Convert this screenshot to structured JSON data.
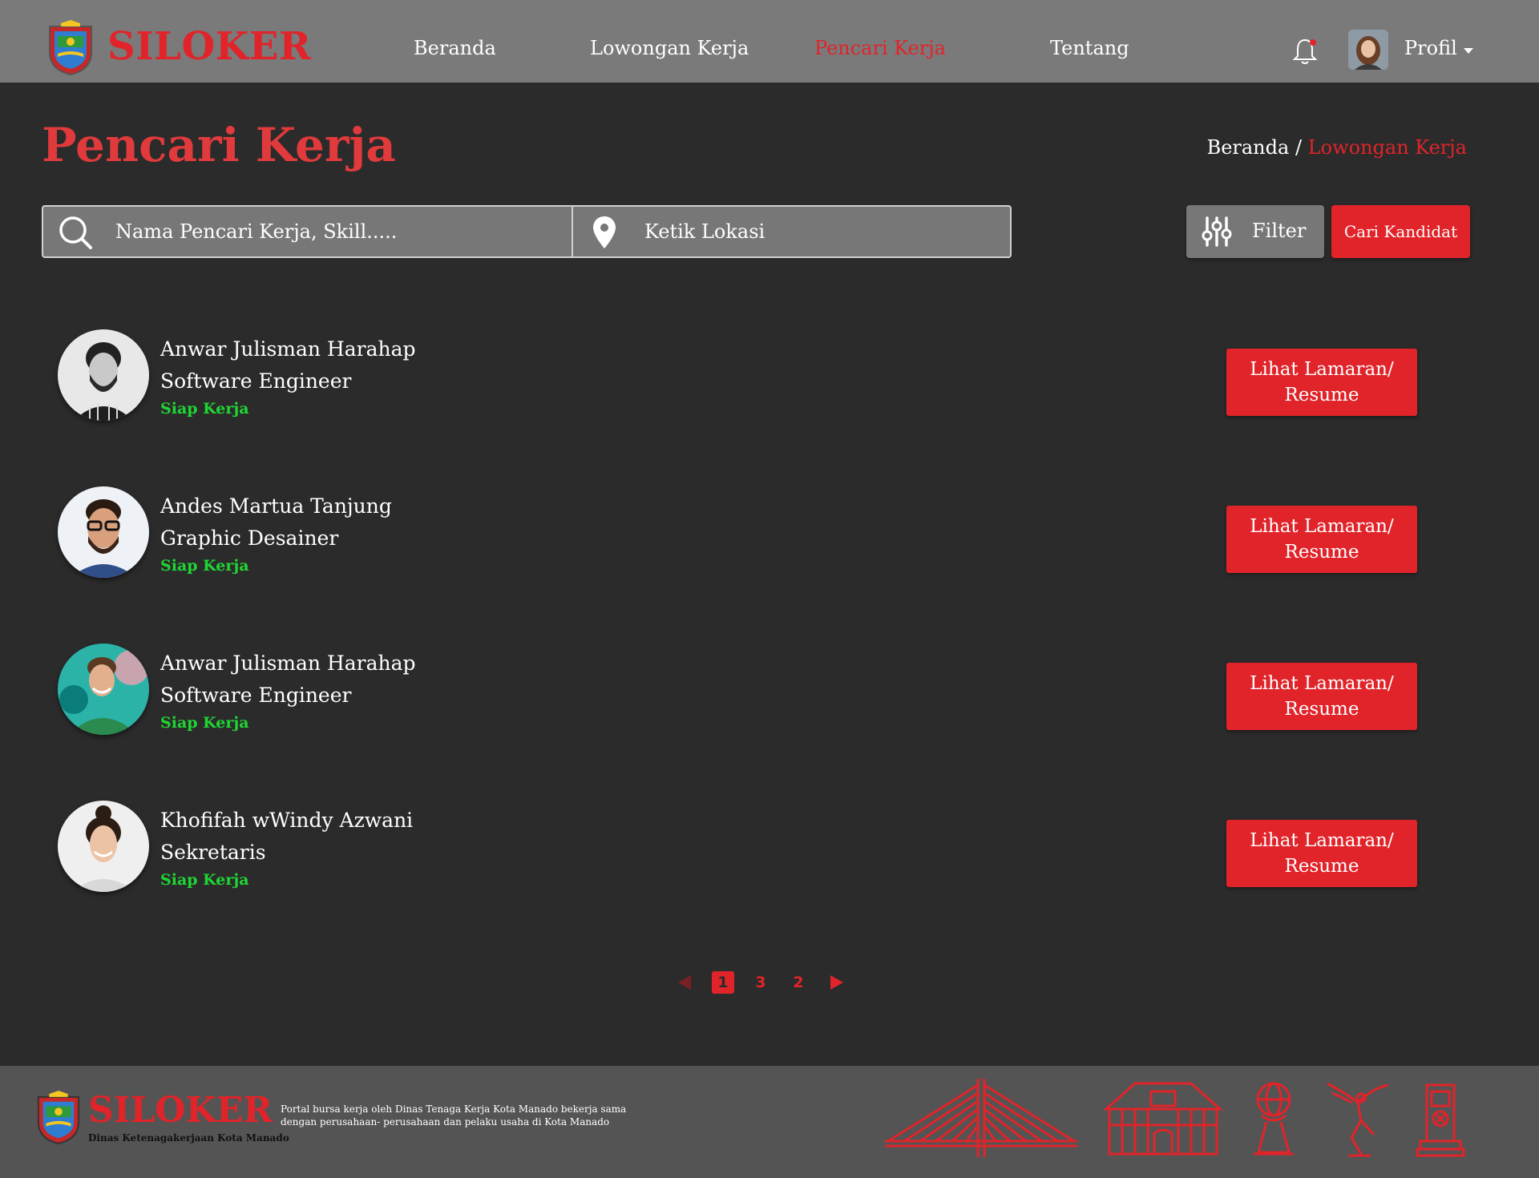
{
  "app": {
    "brand": "SILOKER"
  },
  "nav": {
    "items": [
      {
        "label": "Beranda",
        "active": false
      },
      {
        "label": "Lowongan Kerja",
        "active": false
      },
      {
        "label": "Pencari Kerja",
        "active": true
      },
      {
        "label": "Tentang",
        "active": false
      }
    ],
    "profile_label": "Profil",
    "icons": {
      "notification": "bell-icon",
      "dropdown": "caret-down-icon"
    }
  },
  "header": {
    "title": "Pencari Kerja",
    "breadcrumb": {
      "home": "Beranda",
      "separator": "/",
      "current": "Lowongan Kerja"
    }
  },
  "search": {
    "keyword_placeholder": "Nama Pencari Kerja, Skill.....",
    "location_placeholder": "Ketik Lokasi",
    "filter_label": "Filter",
    "submit_label": "Cari Kandidat"
  },
  "candidates": [
    {
      "name": "Anwar Julisman Harahap",
      "role": "Software Engineer",
      "status": "Siap Kerja",
      "button_line1": "Lihat Lamaran/",
      "button_line2": "Resume"
    },
    {
      "name": "Andes Martua Tanjung",
      "role": "Graphic Desainer",
      "status": "Siap Kerja",
      "button_line1": "Lihat Lamaran/",
      "button_line2": "Resume"
    },
    {
      "name": "Anwar Julisman Harahap",
      "role": "Software Engineer",
      "status": "Siap Kerja",
      "button_line1": "Lihat Lamaran/",
      "button_line2": "Resume"
    },
    {
      "name": "Khofifah wWindy Azwani",
      "role": "Sekretaris",
      "status": "Siap Kerja",
      "button_line1": "Lihat Lamaran/",
      "button_line2": "Resume"
    }
  ],
  "pagination": {
    "pages": [
      "1",
      "3",
      "2"
    ],
    "current": "1"
  },
  "footer": {
    "brand": "SILOKER",
    "subtitle": "Dinas Ketenagakerjaan Kota Manado",
    "description": "Portal bursa kerja oleh Dinas Tenaga Kerja Kota Manado bekerja sama dengan perusahaan- perusahaan dan pelaku usaha di Kota Manado"
  },
  "colors": {
    "accent": "#e0242a",
    "navbar": "#7a7a7a",
    "background": "#2b2b2b",
    "status_green": "#1fd633",
    "footer": "#545454"
  }
}
